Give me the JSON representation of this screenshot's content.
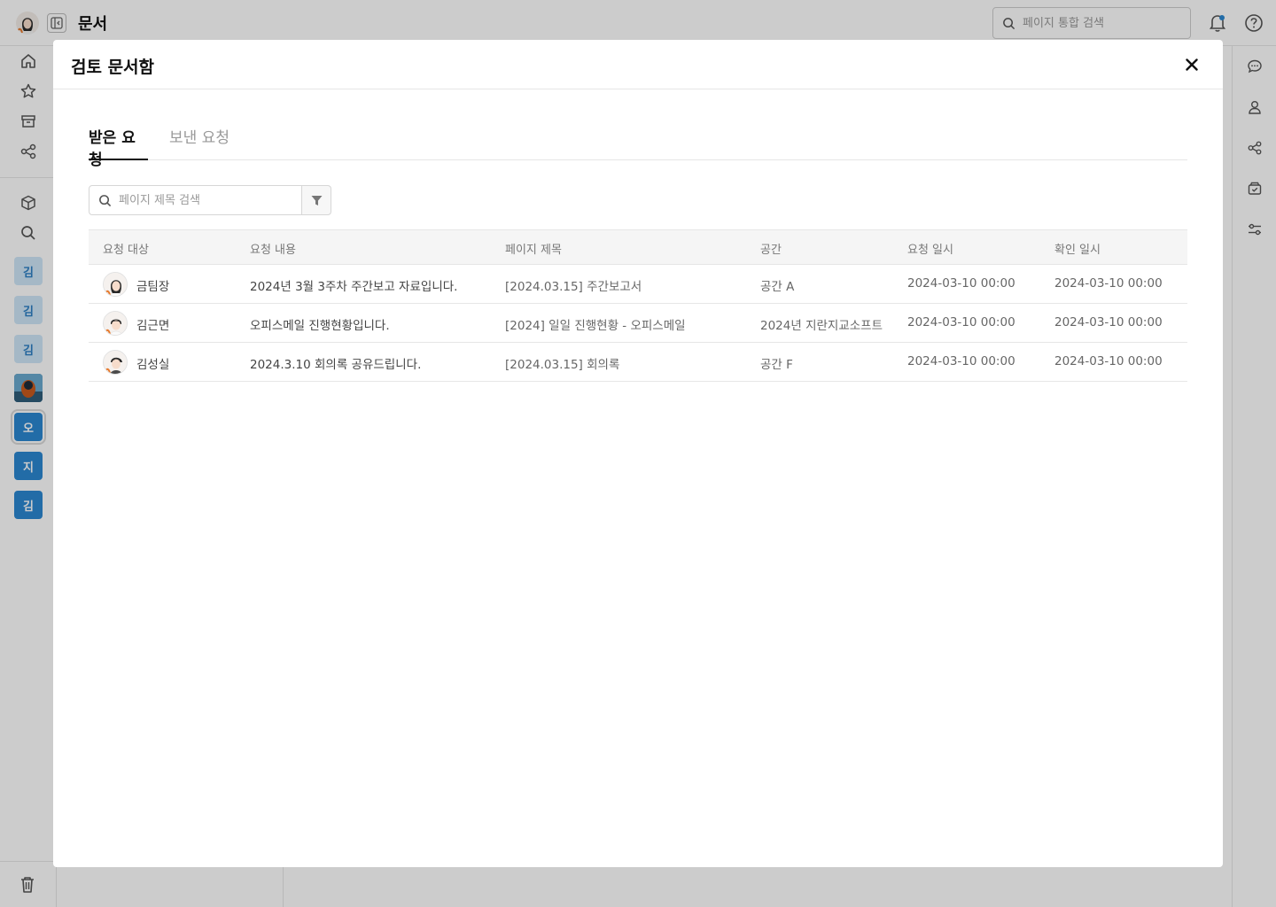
{
  "app": {
    "title": "문서",
    "global_search_placeholder": "페이지 통합 검색",
    "spaces": [
      "김",
      "김",
      "김",
      "오",
      "지",
      "김"
    ]
  },
  "modal": {
    "title": "검토 문서함",
    "tabs": [
      {
        "label": "받은 요청",
        "active": true
      },
      {
        "label": "보낸 요청",
        "active": false
      }
    ],
    "search_placeholder": "페이지 제목 검색",
    "columns": [
      "요청 대상",
      "요청 내용",
      "페이지 제목",
      "공간",
      "요청 일시",
      "확인 일시"
    ],
    "rows": [
      {
        "target": "금팀장",
        "content": "2024년 3월 3주차 주간보고 자료입니다.",
        "page": "[2024.03.15] 주간보고서",
        "space": "공간 A",
        "requested": "2024-03-10 00:00",
        "confirmed": "2024-03-10 00:00"
      },
      {
        "target": "김근면",
        "content": "오피스메일 진행현황입니다.",
        "page": "[2024] 일일 진행현황 - 오피스메일",
        "space": "2024년 지란지교소프트",
        "requested": "2024-03-10 00:00",
        "confirmed": "2024-03-10 00:00"
      },
      {
        "target": "김성실",
        "content": "2024.3.10 회의록 공유드립니다.",
        "page": "[2024.03.15] 회의록",
        "space": "공간 F",
        "requested": "2024-03-10 00:00",
        "confirmed": "2024-03-10 00:00"
      }
    ]
  },
  "colors": {
    "accent_badge": "#2b87d1",
    "accent_badge_light": "#cfe6f8",
    "overlay": "rgba(0,0,0,0.2)"
  },
  "icons": {
    "topbar": [
      "avatar",
      "sidebar-collapse-icon",
      "search-icon",
      "bell-icon",
      "help-icon"
    ],
    "leftnav": [
      "home-icon",
      "star-icon",
      "archive-icon",
      "share-icon",
      "cube-icon",
      "search-icon",
      "trash-icon"
    ],
    "rightrail": [
      "comment-icon",
      "person-icon",
      "share-icon",
      "inbox-check-icon",
      "sliders-icon"
    ]
  }
}
